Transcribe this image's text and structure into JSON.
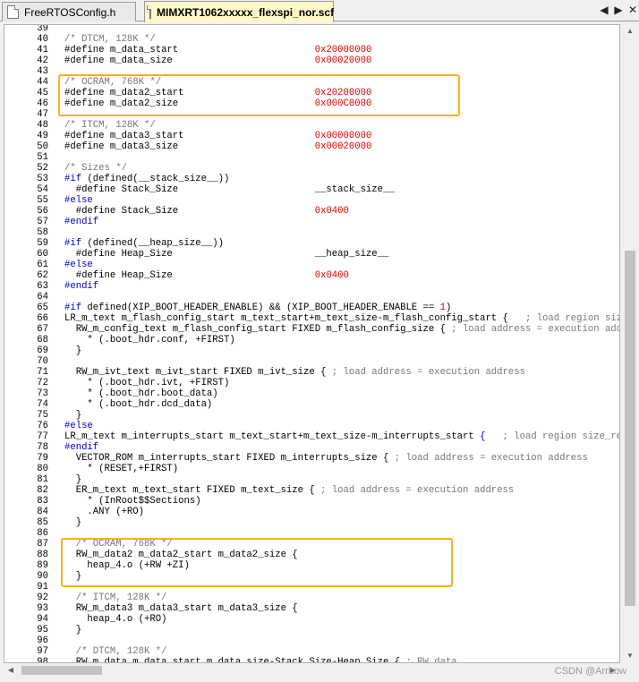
{
  "tabs": [
    {
      "label": "FreeRTOSConfig.h",
      "active": false
    },
    {
      "label": "MIMXRT1062xxxxx_flexspi_nor.scf",
      "active": true
    }
  ],
  "nav": {
    "prev": "◀",
    "next": "▶",
    "close": "✕"
  },
  "colors": {
    "highlight_box": "#f5b21b",
    "comment": "#777777",
    "keyword": "#0000cc",
    "number": "#e00000"
  },
  "watermark": "CSDN @Arrbow",
  "lines": [
    {
      "n": "39",
      "segs": []
    },
    {
      "n": "40",
      "segs": [
        {
          "t": "/* DTCM, 128K */",
          "c": "cm"
        }
      ]
    },
    {
      "n": "41",
      "segs": [
        {
          "t": "#define m_data_start                        "
        },
        {
          "t": "0x20000000",
          "c": "nm"
        }
      ]
    },
    {
      "n": "42",
      "segs": [
        {
          "t": "#define m_data_size                         "
        },
        {
          "t": "0x00020000",
          "c": "nm"
        }
      ]
    },
    {
      "n": "43",
      "segs": []
    },
    {
      "n": "44",
      "segs": [
        {
          "t": "/* OCRAM, 768K */",
          "c": "cm"
        }
      ]
    },
    {
      "n": "45",
      "segs": [
        {
          "t": "#define m_data2_start                       "
        },
        {
          "t": "0x20200000",
          "c": "nm"
        }
      ]
    },
    {
      "n": "46",
      "segs": [
        {
          "t": "#define m_data2_size                        "
        },
        {
          "t": "0x000C0000",
          "c": "nm"
        }
      ]
    },
    {
      "n": "47",
      "segs": []
    },
    {
      "n": "48",
      "segs": [
        {
          "t": "/* ITCM, 128K */",
          "c": "cm"
        }
      ]
    },
    {
      "n": "49",
      "segs": [
        {
          "t": "#define m_data3_start                       "
        },
        {
          "t": "0x00000000",
          "c": "nm"
        }
      ]
    },
    {
      "n": "50",
      "segs": [
        {
          "t": "#define m_data3_size                        "
        },
        {
          "t": "0x00020000",
          "c": "nm"
        }
      ]
    },
    {
      "n": "51",
      "segs": []
    },
    {
      "n": "52",
      "segs": [
        {
          "t": "/* Sizes */",
          "c": "cm"
        }
      ]
    },
    {
      "n": "53",
      "segs": [
        {
          "t": "#if",
          "c": "kw"
        },
        {
          "t": " (defined(__stack_size__))"
        }
      ]
    },
    {
      "n": "54",
      "segs": [
        {
          "t": "  #define Stack_Size                        __stack_size__"
        }
      ]
    },
    {
      "n": "55",
      "segs": [
        {
          "t": "#else",
          "c": "kw"
        }
      ]
    },
    {
      "n": "56",
      "segs": [
        {
          "t": "  #define Stack_Size                        "
        },
        {
          "t": "0x0400",
          "c": "nm"
        }
      ]
    },
    {
      "n": "57",
      "segs": [
        {
          "t": "#endif",
          "c": "kw"
        }
      ]
    },
    {
      "n": "58",
      "segs": []
    },
    {
      "n": "59",
      "segs": [
        {
          "t": "#if",
          "c": "kw"
        },
        {
          "t": " (defined(__heap_size__))"
        }
      ]
    },
    {
      "n": "60",
      "segs": [
        {
          "t": "  #define Heap_Size                         __heap_size__"
        }
      ]
    },
    {
      "n": "61",
      "segs": [
        {
          "t": "#else",
          "c": "kw"
        }
      ]
    },
    {
      "n": "62",
      "segs": [
        {
          "t": "  #define Heap_Size                         "
        },
        {
          "t": "0x0400",
          "c": "nm"
        }
      ]
    },
    {
      "n": "63",
      "segs": [
        {
          "t": "#endif",
          "c": "kw"
        }
      ]
    },
    {
      "n": "64",
      "segs": []
    },
    {
      "n": "65",
      "segs": [
        {
          "t": "#if",
          "c": "kw"
        },
        {
          "t": " defined(XIP_BOOT_HEADER_ENABLE) && (XIP_BOOT_HEADER_ENABLE == "
        },
        {
          "t": "1",
          "c": "nm"
        },
        {
          "t": ")"
        }
      ]
    },
    {
      "n": "66",
      "segs": [
        {
          "t": "LR_m_text m_flash_config_start m_text_start+m_text_size-m_flash_config_start {   "
        },
        {
          "t": "; load region size_reg",
          "c": "cm"
        }
      ]
    },
    {
      "n": "67",
      "segs": [
        {
          "t": "  RW_m_config_text m_flash_config_start FIXED m_flash_config_size { "
        },
        {
          "t": "; load address = execution address",
          "c": "cm"
        }
      ]
    },
    {
      "n": "68",
      "segs": [
        {
          "t": "    * (.boot_hdr.conf, +FIRST)"
        }
      ]
    },
    {
      "n": "69",
      "segs": [
        {
          "t": "  }"
        }
      ]
    },
    {
      "n": "70",
      "segs": []
    },
    {
      "n": "71",
      "segs": [
        {
          "t": "  RW_m_ivt_text m_ivt_start FIXED m_ivt_size { "
        },
        {
          "t": "; load address = execution address",
          "c": "cm"
        }
      ]
    },
    {
      "n": "72",
      "segs": [
        {
          "t": "    * (.boot_hdr.ivt, +FIRST)"
        }
      ]
    },
    {
      "n": "73",
      "segs": [
        {
          "t": "    * (.boot_hdr.boot_data)"
        }
      ]
    },
    {
      "n": "74",
      "segs": [
        {
          "t": "    * (.boot_hdr.dcd_data)"
        }
      ]
    },
    {
      "n": "75",
      "segs": [
        {
          "t": "  }"
        }
      ]
    },
    {
      "n": "76",
      "segs": [
        {
          "t": "#else",
          "c": "kw"
        }
      ]
    },
    {
      "n": "77",
      "segs": [
        {
          "t": "LR_m_text m_interrupts_start m_text_start+m_text_size-m_interrupts_start "
        },
        {
          "t": "{",
          "c": "kw"
        },
        {
          "t": "   "
        },
        {
          "t": "; load region size_region",
          "c": "cm"
        }
      ]
    },
    {
      "n": "78",
      "segs": [
        {
          "t": "#endif",
          "c": "kw"
        }
      ]
    },
    {
      "n": "79",
      "segs": [
        {
          "t": "  VECTOR_ROM m_interrupts_start FIXED m_interrupts_size { "
        },
        {
          "t": "; load address = execution address",
          "c": "cm"
        }
      ]
    },
    {
      "n": "80",
      "segs": [
        {
          "t": "    * (RESET,+FIRST)"
        }
      ]
    },
    {
      "n": "81",
      "segs": [
        {
          "t": "  }"
        }
      ]
    },
    {
      "n": "82",
      "segs": [
        {
          "t": "  ER_m_text m_text_start FIXED m_text_size { "
        },
        {
          "t": "; load address = execution address",
          "c": "cm"
        }
      ]
    },
    {
      "n": "83",
      "segs": [
        {
          "t": "    * (InRoot$$Sections)"
        }
      ]
    },
    {
      "n": "84",
      "segs": [
        {
          "t": "    .ANY (+RO)"
        }
      ]
    },
    {
      "n": "85",
      "segs": [
        {
          "t": "  }"
        }
      ]
    },
    {
      "n": "86",
      "segs": []
    },
    {
      "n": "87",
      "segs": [
        {
          "t": "  /* OCRAM, 768K */",
          "c": "cm"
        }
      ]
    },
    {
      "n": "88",
      "segs": [
        {
          "t": "  RW_m_data2 m_data2_start m_data2_size {"
        }
      ]
    },
    {
      "n": "89",
      "segs": [
        {
          "t": "    heap_4.o (+RW +ZI)"
        }
      ]
    },
    {
      "n": "90",
      "segs": [
        {
          "t": "  }"
        }
      ]
    },
    {
      "n": "91",
      "segs": []
    },
    {
      "n": "92",
      "segs": [
        {
          "t": "  /* ITCM, 128K */",
          "c": "cm"
        }
      ]
    },
    {
      "n": "93",
      "segs": [
        {
          "t": "  RW_m_data3 m_data3_start m_data3_size {"
        }
      ]
    },
    {
      "n": "94",
      "segs": [
        {
          "t": "    heap_4.o (+RO)"
        }
      ]
    },
    {
      "n": "95",
      "segs": [
        {
          "t": "  }"
        }
      ]
    },
    {
      "n": "96",
      "segs": []
    },
    {
      "n": "97",
      "segs": [
        {
          "t": "  /* DTCM, 128K */",
          "c": "cm"
        }
      ]
    },
    {
      "n": "98",
      "segs": [
        {
          "t": "  RW_m_data m_data_start m_data_size-Stack_Size-Heap_Size { "
        },
        {
          "t": "; RW data",
          "c": "cm"
        }
      ]
    }
  ]
}
